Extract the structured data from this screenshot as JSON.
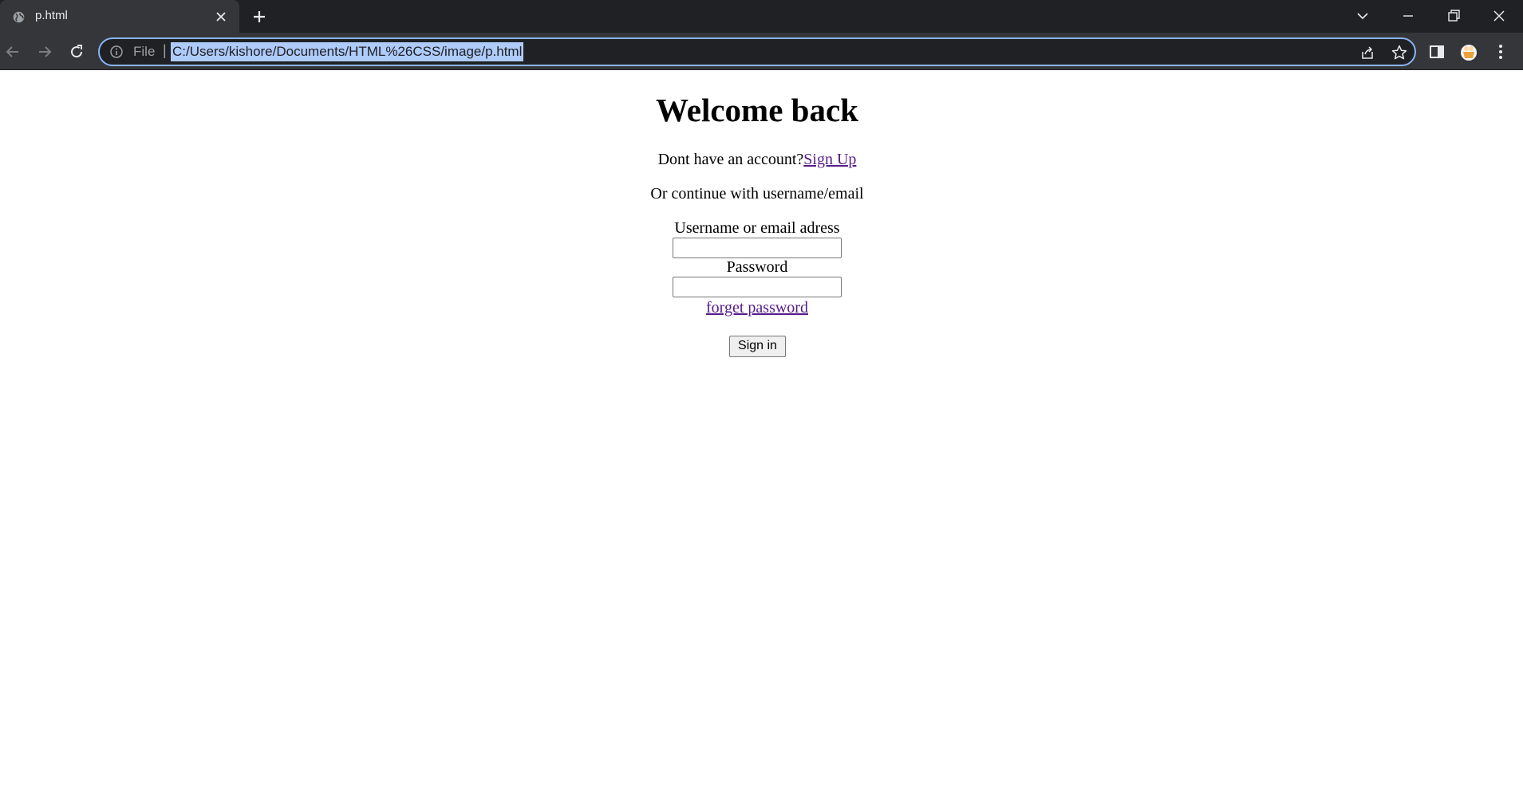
{
  "browser": {
    "tab": {
      "title": "p.html",
      "favicon": "globe-icon"
    },
    "address_bar": {
      "scheme_label": "File",
      "separator": "|",
      "url": "C:/Users/kishore/Documents/HTML%26CSS/image/p.html"
    },
    "colors": {
      "tabstrip_bg": "#202124",
      "toolbar_bg": "#35363a",
      "focus_ring": "#8ab4f8",
      "url_selection": "#aecbfa"
    }
  },
  "page": {
    "heading": "Welcome back",
    "signup_prompt": "Dont have an account?",
    "signup_link": "Sign Up",
    "continue_text": "Or continue with username/email",
    "username_label": "Username or email adress",
    "username_value": "",
    "password_label": "Password",
    "password_value": "",
    "forgot_link": "forget password",
    "signin_button": "Sign in",
    "link_color": "#551a8b"
  }
}
